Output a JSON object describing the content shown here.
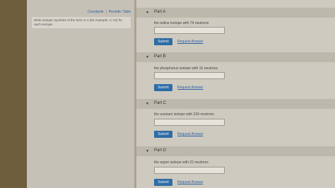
{
  "left": {
    "constants_link": "Constants",
    "separator": "|",
    "periodic_table_link": "Periodic Table",
    "instructions": "Write isotopic symbols of the form X-A (for example, C-13) for each isotope."
  },
  "parts": [
    {
      "title": "Part A",
      "question": "the iodine isotope with 74 neutrons",
      "submit": "Submit",
      "request": "Request Answer"
    },
    {
      "title": "Part B",
      "question": "the phosphorus isotope with 16 neutrons",
      "submit": "Submit",
      "request": "Request Answer"
    },
    {
      "title": "Part C",
      "question": "the uranium isotope with 234 neutrons",
      "submit": "Submit",
      "request": "Request Answer"
    },
    {
      "title": "Part D",
      "question": "the argon isotope with 22 neutrons",
      "submit": "Submit",
      "request": "Request Answer"
    }
  ],
  "icons": {
    "collapse": "chevron-down-icon"
  }
}
